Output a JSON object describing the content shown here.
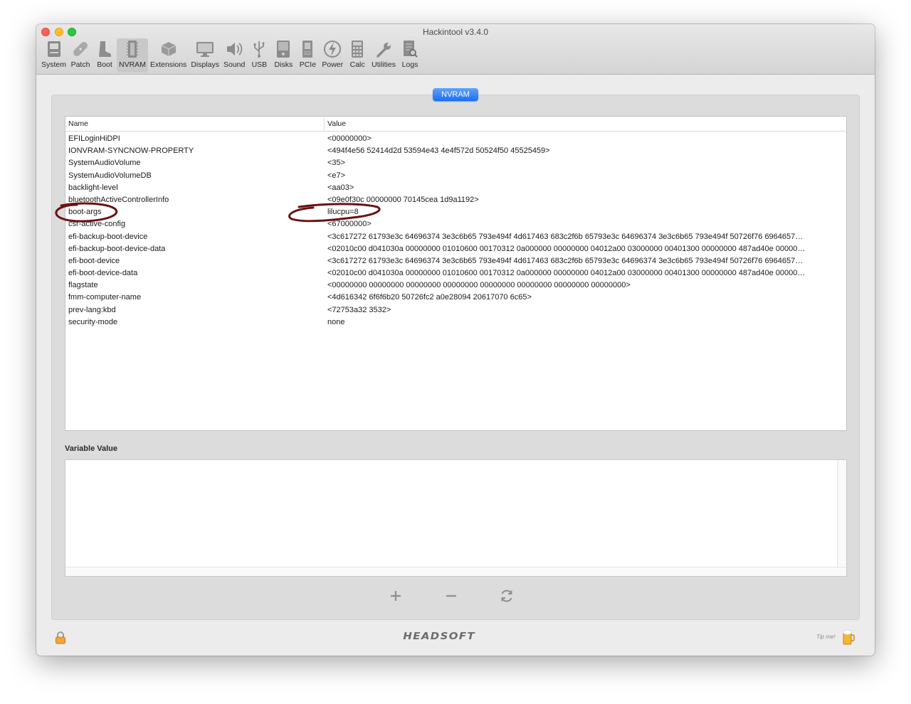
{
  "window": {
    "title": "Hackintool v3.4.0"
  },
  "toolbar": {
    "items": [
      {
        "label": "System",
        "icon": "system-icon"
      },
      {
        "label": "Patch",
        "icon": "patch-icon"
      },
      {
        "label": "Boot",
        "icon": "boot-icon"
      },
      {
        "label": "NVRAM",
        "icon": "nvram-icon",
        "active": true
      },
      {
        "label": "Extensions",
        "icon": "extensions-icon"
      },
      {
        "label": "Displays",
        "icon": "displays-icon"
      },
      {
        "label": "Sound",
        "icon": "sound-icon"
      },
      {
        "label": "USB",
        "icon": "usb-icon"
      },
      {
        "label": "Disks",
        "icon": "disks-icon"
      },
      {
        "label": "PCIe",
        "icon": "pcie-icon"
      },
      {
        "label": "Power",
        "icon": "power-icon"
      },
      {
        "label": "Calc",
        "icon": "calc-icon"
      },
      {
        "label": "Utilities",
        "icon": "utilities-icon"
      },
      {
        "label": "Logs",
        "icon": "logs-icon"
      }
    ]
  },
  "panel": {
    "badge": "NVRAM"
  },
  "table": {
    "columns": {
      "name": "Name",
      "value": "Value"
    },
    "rows": [
      {
        "name": "EFILoginHiDPI",
        "value": "<00000000>"
      },
      {
        "name": "IONVRAM-SYNCNOW-PROPERTY",
        "value": "<494f4e56 52414d2d 53594e43 4e4f572d 50524f50 45525459>"
      },
      {
        "name": "SystemAudioVolume",
        "value": "<35>"
      },
      {
        "name": "SystemAudioVolumeDB",
        "value": "<e7>"
      },
      {
        "name": "backlight-level",
        "value": "<aa03>"
      },
      {
        "name": "bluetoothActiveControllerInfo",
        "value": "<09e0f30c 00000000 70145cea 1d9a1192>"
      },
      {
        "name": "boot-args",
        "value": "lilucpu=8"
      },
      {
        "name": "csr-active-config",
        "value": "<67000000>"
      },
      {
        "name": "efi-backup-boot-device",
        "value": "<3c617272 61793e3c 64696374 3e3c6b65 793e494f 4d617463 683c2f6b 65793e3c 64696374 3e3c6b65 793e494f 50726f76 6964657…"
      },
      {
        "name": "efi-backup-boot-device-data",
        "value": "<02010c00 d041030a 00000000 01010600 00170312 0a000000 00000000 04012a00 03000000 00401300 00000000 487ad40e 00000…"
      },
      {
        "name": "efi-boot-device",
        "value": "<3c617272 61793e3c 64696374 3e3c6b65 793e494f 4d617463 683c2f6b 65793e3c 64696374 3e3c6b65 793e494f 50726f76 6964657…"
      },
      {
        "name": "efi-boot-device-data",
        "value": "<02010c00 d041030a 00000000 01010600 00170312 0a000000 00000000 04012a00 03000000 00401300 00000000 487ad40e 00000…"
      },
      {
        "name": "flagstate",
        "value": "<00000000 00000000 00000000 00000000 00000000 00000000 00000000 00000000>"
      },
      {
        "name": "fmm-computer-name",
        "value": "<4d616342 6f6f6b20 50726fc2 a0e28094 20617070 6c65>"
      },
      {
        "name": "prev-lang:kbd",
        "value": "<72753a32 3532>"
      },
      {
        "name": "security-mode",
        "value": "none"
      }
    ]
  },
  "variable_value": {
    "label": "Variable Value",
    "text": ""
  },
  "actions": {
    "add": "+",
    "remove": "−"
  },
  "footer": {
    "logo_text": "HEADSOFT",
    "tip_text": "Tip me!"
  },
  "colors": {
    "accent": "#1b6ef5",
    "annotation": "#6b1212"
  }
}
